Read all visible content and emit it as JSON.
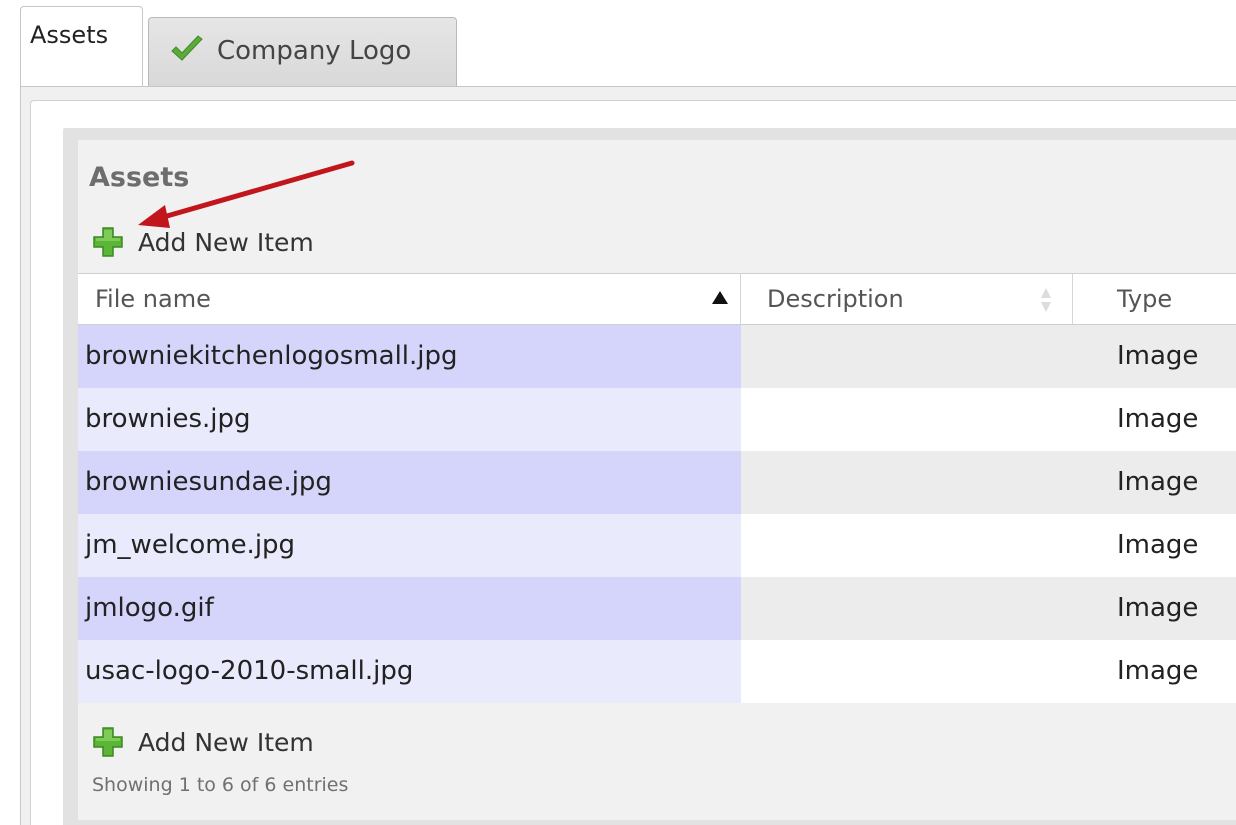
{
  "tabs": [
    {
      "label": "Assets",
      "active": true
    },
    {
      "label": "Company Logo",
      "active": false,
      "icon": "checkmark-icon"
    }
  ],
  "panel": {
    "title": "Assets",
    "add_label_top": "Add New Item",
    "add_label_bottom": "Add New Item",
    "info": "Showing 1 to 6 of 6 entries"
  },
  "table": {
    "columns": [
      {
        "label": "File name",
        "sort": "ascending"
      },
      {
        "label": "Description",
        "sort": "none"
      },
      {
        "label": "Type",
        "sort": "none"
      }
    ],
    "rows": [
      {
        "file": "browniekitchenlogosmall.jpg",
        "description": "",
        "type": "Image"
      },
      {
        "file": "brownies.jpg",
        "description": "",
        "type": "Image"
      },
      {
        "file": "browniesundae.jpg",
        "description": "",
        "type": "Image"
      },
      {
        "file": "jm_welcome.jpg",
        "description": "",
        "type": "Image"
      },
      {
        "file": "jmlogo.gif",
        "description": "",
        "type": "Image"
      },
      {
        "file": "usac-logo-2010-small.jpg",
        "description": "",
        "type": "Image"
      }
    ]
  },
  "colors": {
    "row_file_odd": "#d5d5fb",
    "row_file_even": "#eaeafd",
    "plus_icon": "#4aa52e",
    "check_icon": "#5cab3a",
    "annotation_arrow": "#c0161c"
  },
  "icons": {
    "plus": "plus-icon",
    "check": "checkmark-icon",
    "sort_up": "sort-ascending-icon",
    "sort_both": "sort-both-icon"
  }
}
